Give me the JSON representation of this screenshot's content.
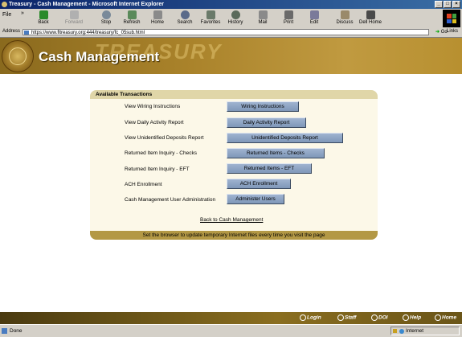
{
  "window": {
    "title": "Treasury - Cash Management - Microsoft Internet Explorer",
    "controls": [
      "_",
      "□",
      "×"
    ]
  },
  "menu": {
    "file": "File",
    "more": "»"
  },
  "toolbar": [
    {
      "label": "Back",
      "icon": "back-arrow-icon",
      "color": "#2a8a2a"
    },
    {
      "label": "Forward",
      "icon": "forward-arrow-icon",
      "color": "#9a9a9a"
    },
    {
      "label": "Stop",
      "icon": "stop-icon",
      "color": "#c03020"
    },
    {
      "label": "Refresh",
      "icon": "refresh-icon",
      "color": "#2a7a3a"
    },
    {
      "label": "Home",
      "icon": "home-icon",
      "color": "#7a7a7a"
    },
    {
      "label": "Search",
      "icon": "search-icon",
      "color": "#5a6a8a"
    },
    {
      "label": "Favorites",
      "icon": "favorites-icon",
      "color": "#c8a020"
    },
    {
      "label": "History",
      "icon": "history-icon",
      "color": "#5a7a5a"
    },
    {
      "label": "Mail",
      "icon": "mail-icon",
      "color": "#8a8a8a"
    },
    {
      "label": "Print",
      "icon": "print-icon",
      "color": "#6a6a6a"
    },
    {
      "label": "Edit",
      "icon": "edit-icon",
      "color": "#7a7a9a"
    },
    {
      "label": "Discuss",
      "icon": "discuss-icon",
      "color": "#9a8a6a"
    },
    {
      "label": "Dell Home",
      "icon": "dell-home-icon",
      "color": "#4a4a4a"
    }
  ],
  "address": {
    "label": "Address",
    "url": "https://www.fltreasury.org:444/treasury/fc_05sub.html",
    "go": "Go",
    "links": "Links"
  },
  "header": {
    "title": "Cash Management",
    "watermark": "TREASURY"
  },
  "panel": {
    "heading": "Available Transactions",
    "rows": [
      {
        "label": "View Wiring Instructions",
        "button": "Wiring Instructions"
      },
      {
        "label": "View Daily Activity Report",
        "button": "Daily Activity Report"
      },
      {
        "label": "View Unidentified Deposits Report",
        "button": "Unidentified Deposits Report"
      },
      {
        "label": "Returned Item Inquiry - Checks",
        "button": "Returned Items - Checks"
      },
      {
        "label": "Returned Item Inquiry - EFT",
        "button": "Returned Items - EFT"
      },
      {
        "label": "ACH Enrollment",
        "button": "ACH Enrollment"
      },
      {
        "label": "Cash Management User Administration",
        "button": "Administer Users"
      }
    ],
    "back_link": "Back to Cash Management",
    "footer": "Set the browser to update temporary Internet files every time you visit the page"
  },
  "footnav": [
    {
      "label": "Login",
      "icon": "login-icon"
    },
    {
      "label": "Staff",
      "icon": "staff-icon"
    },
    {
      "label": "DOI",
      "icon": "doi-icon"
    },
    {
      "label": "Help",
      "icon": "help-icon"
    },
    {
      "label": "Home",
      "icon": "home-icon"
    }
  ],
  "status": {
    "text": "Done",
    "zone": "Internet"
  }
}
